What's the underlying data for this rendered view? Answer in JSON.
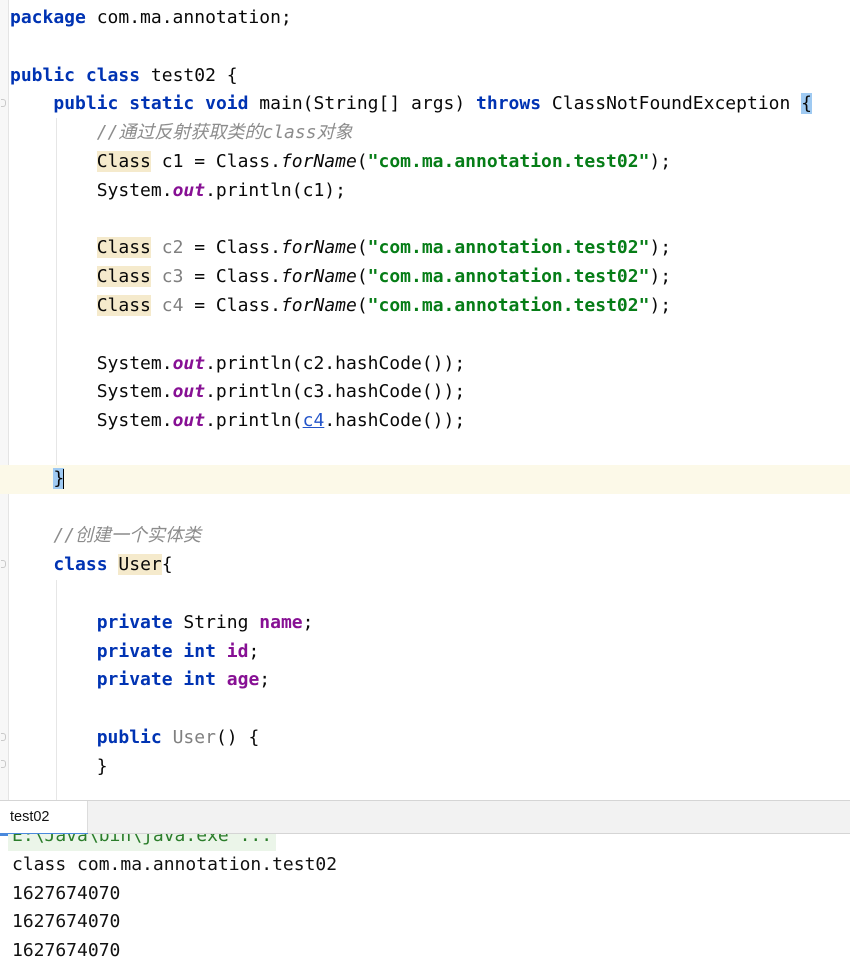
{
  "editor": {
    "lines": [
      {
        "tokens": [
          {
            "t": "package",
            "c": "kw"
          },
          {
            "t": " com.ma.annotation;"
          }
        ]
      },
      {
        "tokens": []
      },
      {
        "tokens": [
          {
            "t": "public",
            "c": "kw"
          },
          {
            "t": " "
          },
          {
            "t": "class",
            "c": "kw"
          },
          {
            "t": " test02 {"
          }
        ]
      },
      {
        "tokens": [
          {
            "t": "    "
          },
          {
            "t": "public",
            "c": "kw"
          },
          {
            "t": " "
          },
          {
            "t": "static",
            "c": "kw"
          },
          {
            "t": " "
          },
          {
            "t": "void",
            "c": "kw"
          },
          {
            "t": " main(String[] args) "
          },
          {
            "t": "throws",
            "c": "kw"
          },
          {
            "t": " ClassNotFoundException "
          },
          {
            "t": "{",
            "c": "brace-match"
          }
        ]
      },
      {
        "tokens": [
          {
            "t": "        "
          },
          {
            "t": "//通过反射获取类的class对象",
            "c": "cmt"
          }
        ]
      },
      {
        "tokens": [
          {
            "t": "        "
          },
          {
            "t": "Class",
            "c": "hl-class"
          },
          {
            "t": " c1 = Class."
          },
          {
            "t": "forName",
            "c": "method-static"
          },
          {
            "t": "("
          },
          {
            "t": "\"com.ma.annotation.test02\"",
            "c": "str"
          },
          {
            "t": ");"
          }
        ]
      },
      {
        "tokens": [
          {
            "t": "        System."
          },
          {
            "t": "out",
            "c": "static-ref"
          },
          {
            "t": ".println(c1);"
          }
        ]
      },
      {
        "tokens": []
      },
      {
        "tokens": [
          {
            "t": "        "
          },
          {
            "t": "Class",
            "c": "hl-class"
          },
          {
            "t": " "
          },
          {
            "t": "c2",
            "c": "unused"
          },
          {
            "t": " = Class."
          },
          {
            "t": "forName",
            "c": "method-static"
          },
          {
            "t": "("
          },
          {
            "t": "\"com.ma.annotation.test02\"",
            "c": "str"
          },
          {
            "t": ");"
          }
        ]
      },
      {
        "tokens": [
          {
            "t": "        "
          },
          {
            "t": "Class",
            "c": "hl-class"
          },
          {
            "t": " "
          },
          {
            "t": "c3",
            "c": "unused"
          },
          {
            "t": " = Class."
          },
          {
            "t": "forName",
            "c": "method-static"
          },
          {
            "t": "("
          },
          {
            "t": "\"com.ma.annotation.test02\"",
            "c": "str"
          },
          {
            "t": ");"
          }
        ]
      },
      {
        "tokens": [
          {
            "t": "        "
          },
          {
            "t": "Class",
            "c": "hl-class"
          },
          {
            "t": " "
          },
          {
            "t": "c4",
            "c": "unused"
          },
          {
            "t": " = Class."
          },
          {
            "t": "forName",
            "c": "method-static"
          },
          {
            "t": "("
          },
          {
            "t": "\"com.ma.annotation.test02\"",
            "c": "str"
          },
          {
            "t": ");"
          }
        ]
      },
      {
        "tokens": []
      },
      {
        "tokens": [
          {
            "t": "        System."
          },
          {
            "t": "out",
            "c": "static-ref"
          },
          {
            "t": ".println(c2.hashCode());"
          }
        ]
      },
      {
        "tokens": [
          {
            "t": "        System."
          },
          {
            "t": "out",
            "c": "static-ref"
          },
          {
            "t": ".println(c3.hashCode());"
          }
        ]
      },
      {
        "tokens": [
          {
            "t": "        System."
          },
          {
            "t": "out",
            "c": "static-ref"
          },
          {
            "t": ".println("
          },
          {
            "t": "c4",
            "c": "link-var"
          },
          {
            "t": ".hashCode());"
          }
        ]
      },
      {
        "tokens": []
      },
      {
        "tokens": [
          {
            "t": "    "
          },
          {
            "t": "}",
            "c": "brace-match"
          }
        ],
        "current": true,
        "caret": true
      },
      {
        "tokens": []
      },
      {
        "tokens": [
          {
            "t": "    "
          },
          {
            "t": "//创建一个实体类",
            "c": "cmt"
          }
        ]
      },
      {
        "tokens": [
          {
            "t": "    "
          },
          {
            "t": "class",
            "c": "kw"
          },
          {
            "t": " "
          },
          {
            "t": "User",
            "c": "hl-class"
          },
          {
            "t": "{"
          }
        ]
      },
      {
        "tokens": []
      },
      {
        "tokens": [
          {
            "t": "        "
          },
          {
            "t": "private",
            "c": "kw"
          },
          {
            "t": " String "
          },
          {
            "t": "name",
            "c": "field"
          },
          {
            "t": ";"
          }
        ]
      },
      {
        "tokens": [
          {
            "t": "        "
          },
          {
            "t": "private",
            "c": "kw"
          },
          {
            "t": " "
          },
          {
            "t": "int",
            "c": "kw"
          },
          {
            "t": " "
          },
          {
            "t": "id",
            "c": "field"
          },
          {
            "t": ";"
          }
        ]
      },
      {
        "tokens": [
          {
            "t": "        "
          },
          {
            "t": "private",
            "c": "kw"
          },
          {
            "t": " "
          },
          {
            "t": "int",
            "c": "kw"
          },
          {
            "t": " "
          },
          {
            "t": "age",
            "c": "field"
          },
          {
            "t": ";"
          }
        ]
      },
      {
        "tokens": []
      },
      {
        "tokens": [
          {
            "t": "        "
          },
          {
            "t": "public",
            "c": "kw"
          },
          {
            "t": " "
          },
          {
            "t": "User",
            "c": "unused"
          },
          {
            "t": "() {"
          }
        ]
      },
      {
        "tokens": [
          {
            "t": "        }"
          }
        ]
      }
    ]
  },
  "run_panel": {
    "tab_label": "test02",
    "console_lines": [
      {
        "text": "E:\\Java\\bin\\java.exe ...",
        "kind": "cmd"
      },
      {
        "text": "class com.ma.annotation.test02",
        "kind": "out"
      },
      {
        "text": "1627674070",
        "kind": "out"
      },
      {
        "text": "1627674070",
        "kind": "out"
      },
      {
        "text": "1627674070",
        "kind": "out"
      }
    ]
  }
}
